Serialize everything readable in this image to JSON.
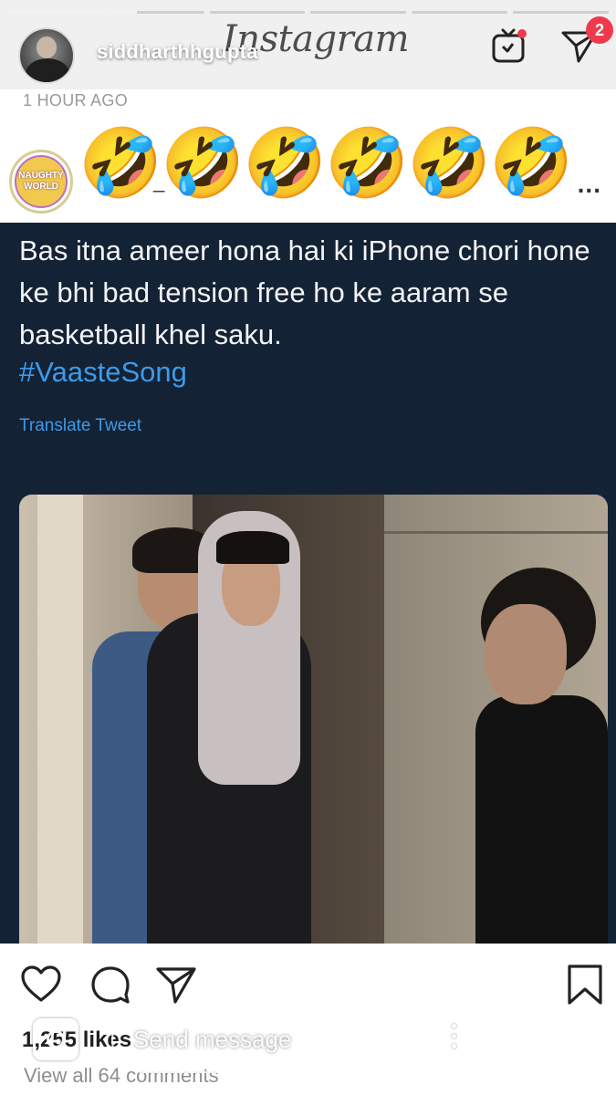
{
  "story": {
    "progress": [
      1.0,
      0.3,
      0.0,
      0.0,
      0.0,
      0.0
    ],
    "username": "siddharthhgupta",
    "app_logo": "Instagram",
    "badge_count": "2",
    "igtv_icon": "igtv-icon",
    "direct_icon": "paper-plane-icon"
  },
  "post": {
    "time_ago": "1 HOUR AGO",
    "account_logo_text": [
      "NAUGHTY",
      "WORLD"
    ],
    "account_name_partial": "_",
    "emoji": [
      "🤣",
      "🤣",
      "🤣",
      "🤣",
      "🤣",
      "🤣"
    ],
    "more": "..."
  },
  "tweet": {
    "text": "Bas itna ameer hona hai ki iPhone chori hone ke bhi bad tension free ho ke aaram se basketball khel saku.",
    "hashtag": "#VaasteSong",
    "translate": "Translate Tweet"
  },
  "actions": {
    "likes": "1,255 likes",
    "view_comments": "View all 64 comments"
  },
  "reply": {
    "placeholder": "Send message"
  },
  "colors": {
    "tweet_bg": "#142235",
    "link_blue": "#3d9be9",
    "badge_red": "#ef3a4e"
  }
}
